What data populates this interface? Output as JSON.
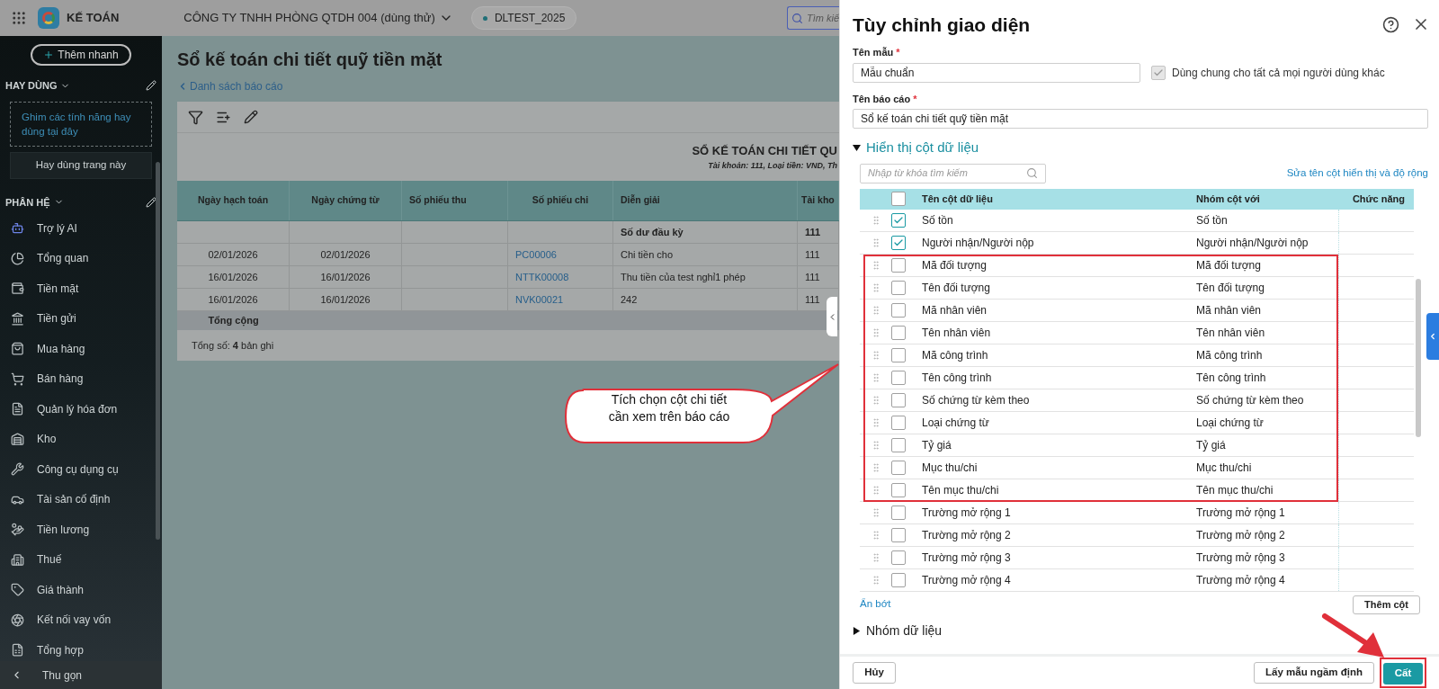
{
  "topbar": {
    "app_name": "KẾ TOÁN",
    "company": "CÔNG TY TNHH PHÒNG QTDH 004 (dùng thử)",
    "database": "DLTEST_2025",
    "search_placeholder": "Tìm kiế"
  },
  "sidebar": {
    "quick_add": "Thêm nhanh",
    "favorites_title": "HAY DÙNG",
    "favorites_hint": "Ghim các tính năng hay dùng tại đây",
    "favorites_button": "Hay dùng trang này",
    "modules_title": "PHÂN HỆ",
    "items": [
      {
        "label": "Trợ lý AI"
      },
      {
        "label": "Tổng quan"
      },
      {
        "label": "Tiền mặt"
      },
      {
        "label": "Tiền gửi"
      },
      {
        "label": "Mua hàng"
      },
      {
        "label": "Bán hàng"
      },
      {
        "label": "Quản lý hóa đơn"
      },
      {
        "label": "Kho"
      },
      {
        "label": "Công cụ dụng cụ"
      },
      {
        "label": "Tài sản cố định"
      },
      {
        "label": "Tiền lương"
      },
      {
        "label": "Thuế"
      },
      {
        "label": "Giá thành"
      },
      {
        "label": "Kết nối vay vốn"
      },
      {
        "label": "Tổng hợp"
      }
    ],
    "collapse": "Thu gọn"
  },
  "page": {
    "title": "Sổ kế toán chi tiết quỹ tiền mặt",
    "back_link": "Danh sách báo cáo",
    "report_title": "SỔ KẾ TOÁN CHI TIẾT QU",
    "report_subtitle": "Tài khoản: 111, Loại tiền: VND, Th",
    "columns": [
      "Ngày hạch toán",
      "Ngày chứng từ",
      "Số phiếu thu",
      "Số phiếu chi",
      "Diễn giải",
      "Tài kho"
    ],
    "rows": [
      {
        "kind": "opening",
        "cells": [
          "",
          "",
          "",
          "",
          "Số dư đầu kỳ",
          "111"
        ]
      },
      {
        "kind": "entry",
        "cells": [
          "02/01/2026",
          "02/01/2026",
          "",
          "PC00006",
          "Chi tiền cho",
          "111"
        ]
      },
      {
        "kind": "entry",
        "cells": [
          "16/01/2026",
          "16/01/2026",
          "",
          "NTTK00008",
          "Thu tiền của test nghỉ1 phép",
          "111"
        ]
      },
      {
        "kind": "entry",
        "cells": [
          "16/01/2026",
          "16/01/2026",
          "",
          "NVK00021",
          "242",
          "111"
        ]
      }
    ],
    "total_label": "Tổng cộng",
    "record_count": "Tổng số: **4** bản ghi"
  },
  "panel": {
    "title": "Tùy chỉnh giao diện",
    "template_label": "Tên mẫu",
    "template_required": "*",
    "report_required": "*",
    "template_name": "Mẫu chuẩn",
    "share": {
      "label": "Dùng chung cho tất cả mọi người dùng khác",
      "checked": true,
      "disabled": true
    },
    "report_label": "Tên báo cáo",
    "report_name": "Sổ kế toán chi tiết quỹ tiền mặt",
    "columns_section": {
      "title": "Hiển thị cột dữ liệu",
      "expanded": true,
      "search_placeholder": "Nhập từ khóa tìm kiếm",
      "edit_link": "Sửa tên cột hiển thị và độ rộng",
      "headers": [
        "Tên cột dữ liệu",
        "Nhóm cột với",
        "Chức năng"
      ],
      "select_all_checked": false,
      "rows": [
        {
          "name": "Số tồn",
          "group": "Số tồn",
          "checked": true
        },
        {
          "name": "Người nhận/Người nộp",
          "group": "Người nhận/Người nộp",
          "checked": true
        },
        {
          "name": "Mã đối tượng",
          "group": "Mã đối tượng",
          "checked": false
        },
        {
          "name": "Tên đối tượng",
          "group": "Tên đối tượng",
          "checked": false
        },
        {
          "name": "Mã nhân viên",
          "group": "Mã nhân viên",
          "checked": false
        },
        {
          "name": "Tên nhân viên",
          "group": "Tên nhân viên",
          "checked": false
        },
        {
          "name": "Mã công trình",
          "group": "Mã công trình",
          "checked": false
        },
        {
          "name": "Tên công trình",
          "group": "Tên công trình",
          "checked": false
        },
        {
          "name": "Số chứng từ kèm theo",
          "group": "Số chứng từ kèm theo",
          "checked": false
        },
        {
          "name": "Loại chứng từ",
          "group": "Loại chứng từ",
          "checked": false
        },
        {
          "name": "Tỷ giá",
          "group": "Tỷ giá",
          "checked": false
        },
        {
          "name": "Mục thu/chi",
          "group": "Mục thu/chi",
          "checked": false
        },
        {
          "name": "Tên mục thu/chi",
          "group": "Tên mục thu/chi",
          "checked": false
        },
        {
          "name": "Trường mở rộng 1",
          "group": "Trường mở rộng 1",
          "checked": false
        },
        {
          "name": "Trường mở rộng 2",
          "group": "Trường mở rộng 2",
          "checked": false
        },
        {
          "name": "Trường mở rộng 3",
          "group": "Trường mở rộng 3",
          "checked": false
        },
        {
          "name": "Trường mở rộng 4",
          "group": "Trường mở rộng 4",
          "checked": false
        }
      ],
      "show_less": "Ẩn bớt",
      "add_column": "Thêm cột"
    },
    "group_section": {
      "title": "Nhóm dữ liệu",
      "expanded": false
    },
    "cancel": "Hủy",
    "restore_default": "Lấy mẫu ngầm định",
    "save": "Cất"
  },
  "callout": {
    "lines": [
      "Tích chọn cột chi tiết",
      "cần xem trên báo cáo"
    ]
  }
}
